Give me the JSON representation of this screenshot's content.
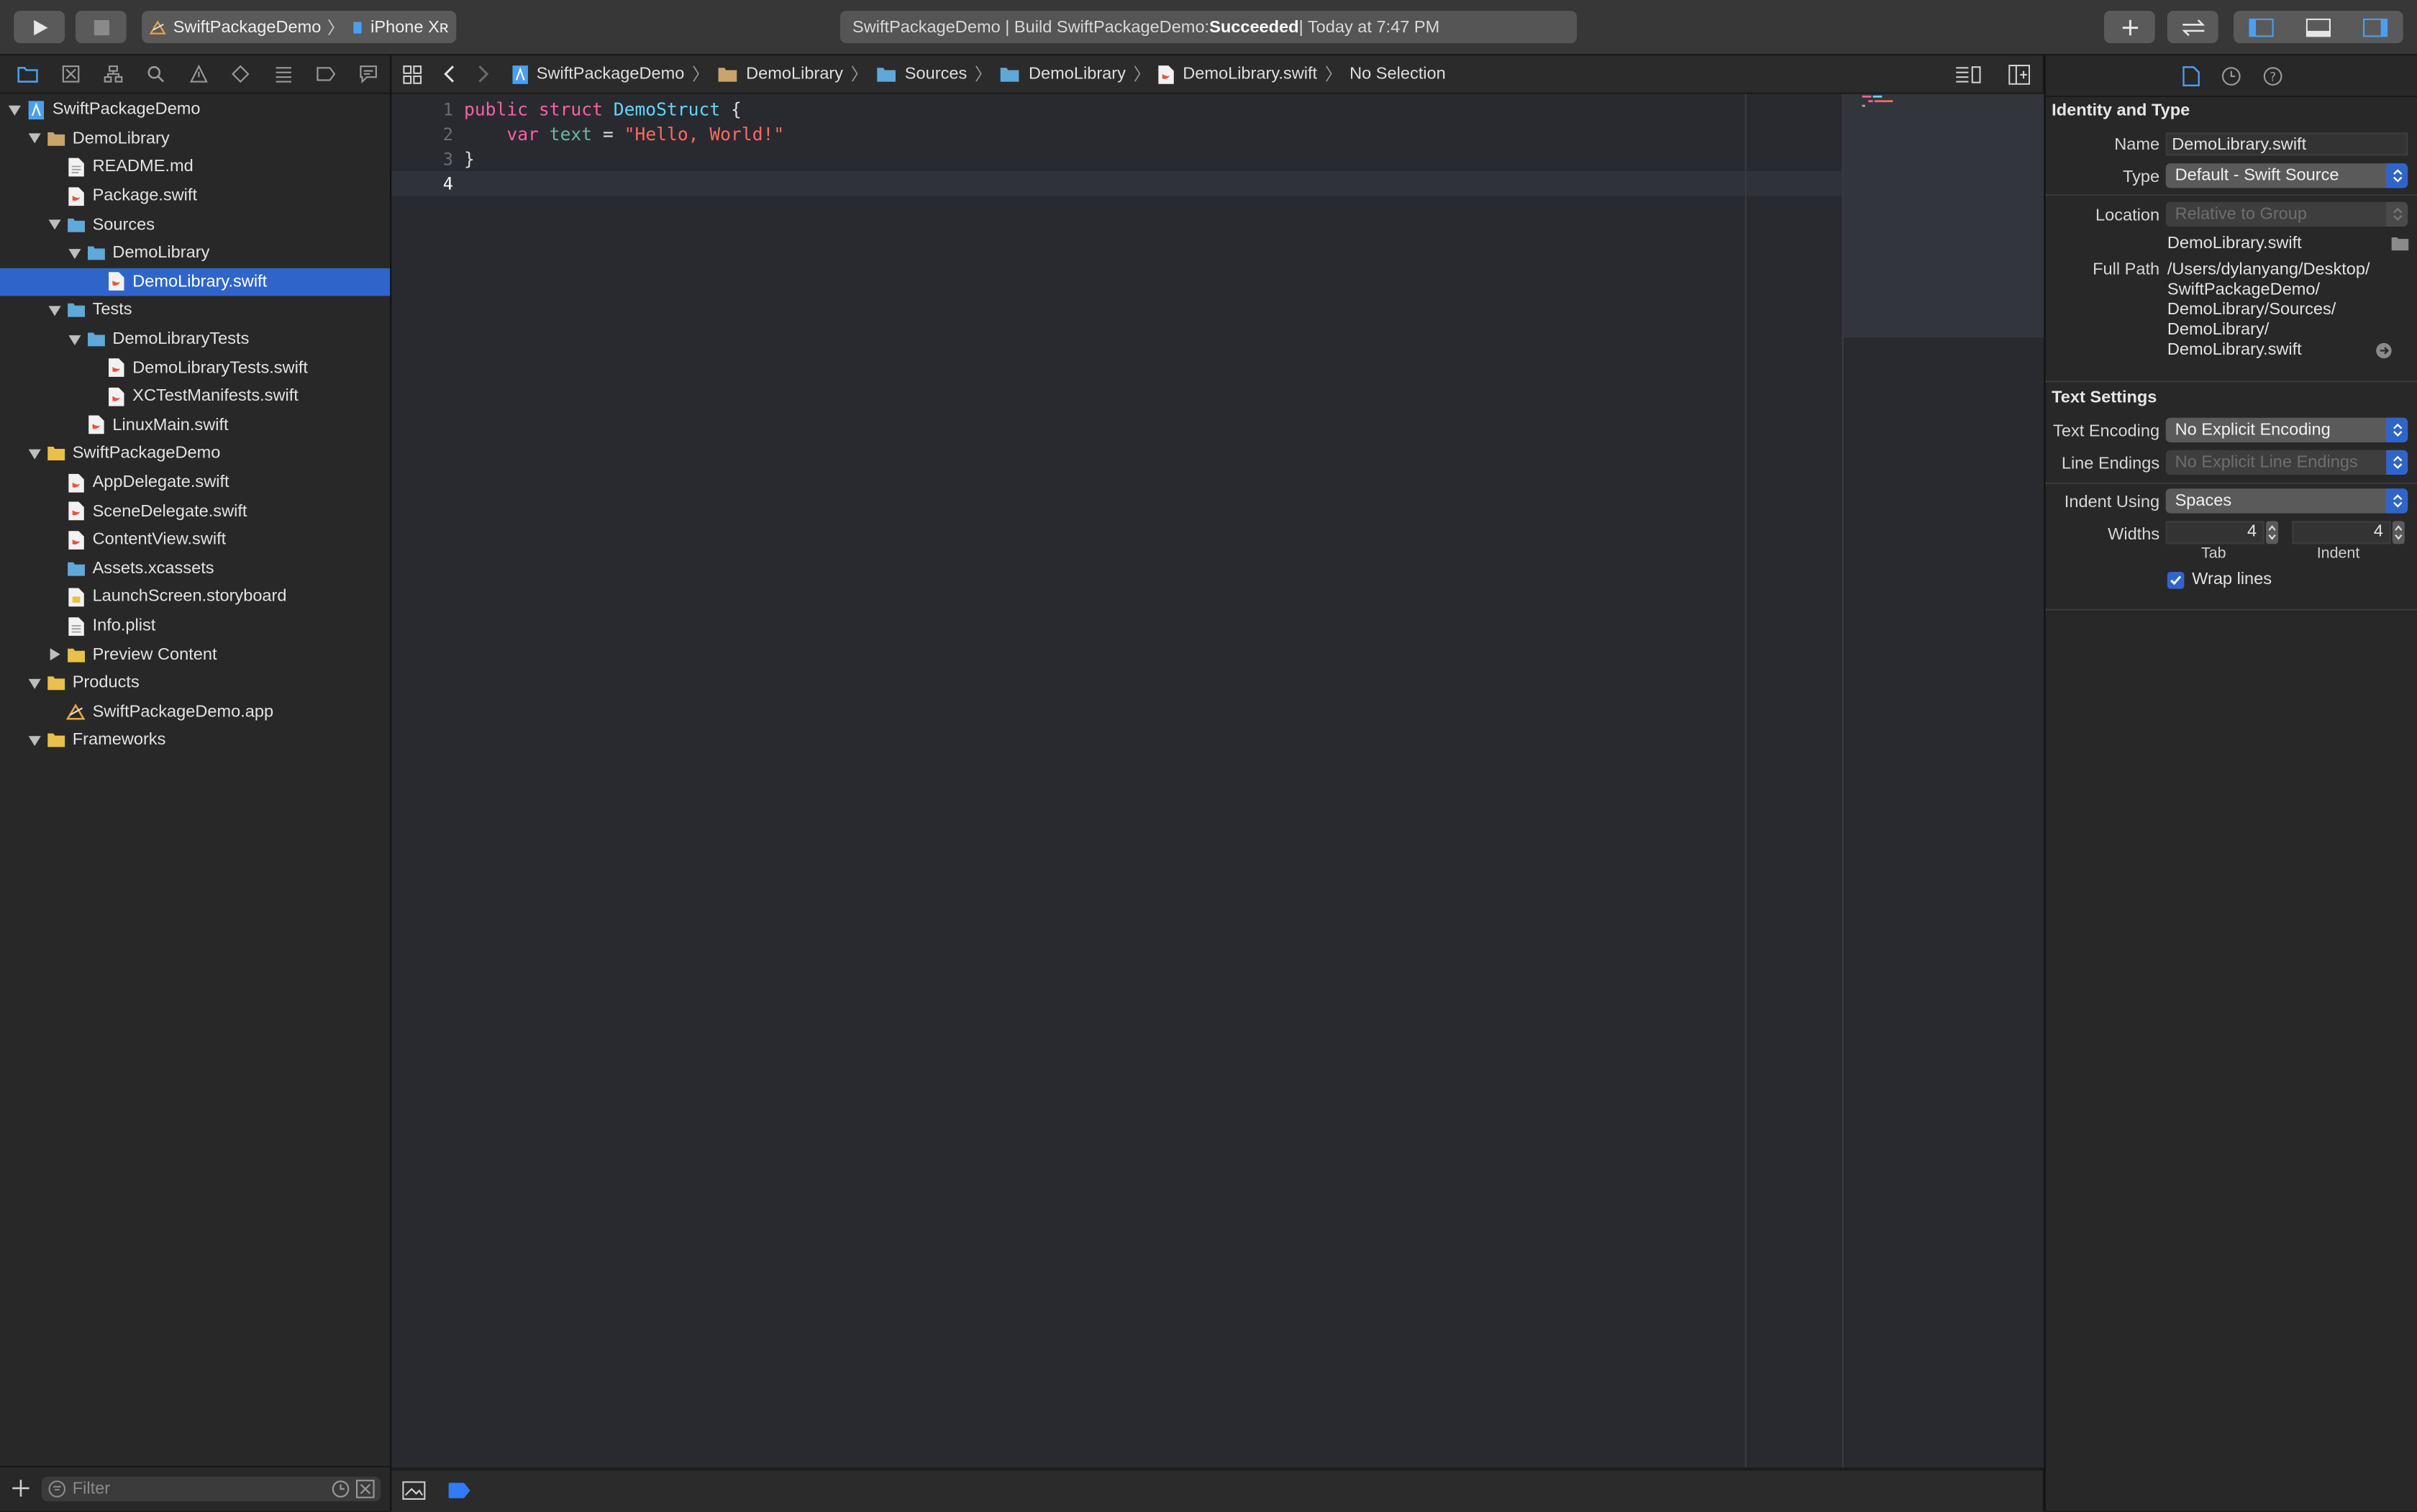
{
  "toolbar": {
    "scheme": "SwiftPackageDemo",
    "device": "iPhone Xʀ",
    "activity_prefix": "SwiftPackageDemo | Build SwiftPackageDemo: ",
    "activity_status": "Succeeded",
    "activity_suffix": " | Today at 7:47 PM"
  },
  "navigator": {
    "filter_placeholder": "Filter",
    "items": [
      {
        "label": "SwiftPackageDemo"
      },
      {
        "label": "DemoLibrary"
      },
      {
        "label": "README.md"
      },
      {
        "label": "Package.swift"
      },
      {
        "label": "Sources"
      },
      {
        "label": "DemoLibrary"
      },
      {
        "label": "DemoLibrary.swift"
      },
      {
        "label": "Tests"
      },
      {
        "label": "DemoLibraryTests"
      },
      {
        "label": "DemoLibraryTests.swift"
      },
      {
        "label": "XCTestManifests.swift"
      },
      {
        "label": "LinuxMain.swift"
      },
      {
        "label": "SwiftPackageDemo"
      },
      {
        "label": "AppDelegate.swift"
      },
      {
        "label": "SceneDelegate.swift"
      },
      {
        "label": "ContentView.swift"
      },
      {
        "label": "Assets.xcassets"
      },
      {
        "label": "LaunchScreen.storyboard"
      },
      {
        "label": "Info.plist"
      },
      {
        "label": "Preview Content"
      },
      {
        "label": "Products"
      },
      {
        "label": "SwiftPackageDemo.app"
      },
      {
        "label": "Frameworks"
      }
    ]
  },
  "jumpbar": {
    "crumbs": [
      "SwiftPackageDemo",
      "DemoLibrary",
      "Sources",
      "DemoLibrary",
      "DemoLibrary.swift",
      "No Selection"
    ]
  },
  "editor": {
    "line_numbers": [
      "1",
      "2",
      "3",
      "4"
    ],
    "code": {
      "l1_kw1": "public",
      "l1_kw2": "struct",
      "l1_name": "DemoStruct",
      "l1_brace": " {",
      "l2_kw": "var",
      "l2_id": "text",
      "l2_eq": " = ",
      "l2_str": "\"Hello, World!\"",
      "l3": "}"
    }
  },
  "inspector": {
    "identity_title": "Identity and Type",
    "name_label": "Name",
    "name_value": "DemoLibrary.swift",
    "type_label": "Type",
    "type_value": "Default - Swift Source",
    "location_label": "Location",
    "location_value": "Relative to Group",
    "location_file": "DemoLibrary.swift",
    "full_path_label": "Full Path",
    "full_path_lines": [
      "/Users/dylanyang/Desktop/",
      "SwiftPackageDemo/",
      "DemoLibrary/Sources/",
      "DemoLibrary/",
      "DemoLibrary.swift"
    ],
    "text_settings_title": "Text Settings",
    "encoding_label": "Text Encoding",
    "encoding_value": "No Explicit Encoding",
    "line_endings_label": "Line Endings",
    "line_endings_value": "No Explicit Line Endings",
    "indent_label": "Indent Using",
    "indent_value": "Spaces",
    "widths_label": "Widths",
    "tab_width": "4",
    "indent_width": "4",
    "tab_caption": "Tab",
    "indent_caption": "Indent",
    "wrap_label": "Wrap lines"
  }
}
